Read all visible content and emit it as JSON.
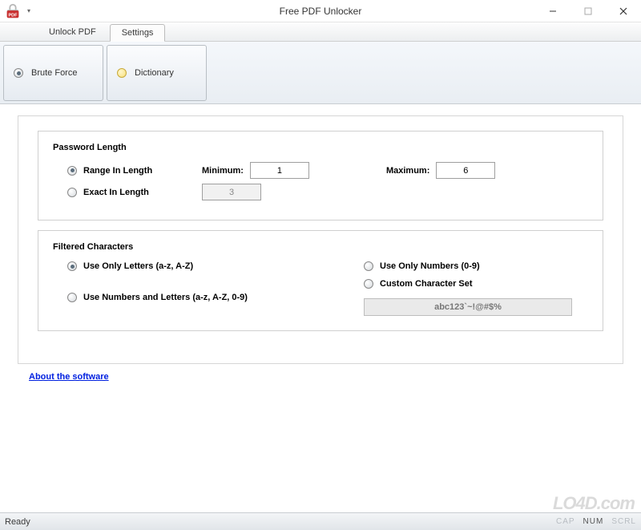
{
  "window": {
    "title": "Free PDF Unlocker"
  },
  "tabs": {
    "unlock": "Unlock PDF",
    "settings": "Settings"
  },
  "ribbon": {
    "brute_force": "Brute Force",
    "dictionary": "Dictionary"
  },
  "password_length": {
    "title": "Password Length",
    "range_label": "Range In Length",
    "exact_label": "Exact In Length",
    "min_label": "Minimum:",
    "max_label": "Maximum:",
    "min_value": "1",
    "max_value": "6",
    "exact_value": "3"
  },
  "filtered": {
    "title": "Filtered Characters",
    "letters": "Use Only Letters (a-z, A-Z)",
    "numbers": "Use Only Numbers (0-9)",
    "numletters": "Use Numbers and Letters (a-z, A-Z, 0-9)",
    "custom": "Custom Character Set",
    "custom_value": "abc123`~!@#$%"
  },
  "link": {
    "about": "About the software"
  },
  "status": {
    "ready": "Ready",
    "cap": "CAP",
    "num": "NUM",
    "scrl": "SCRL"
  },
  "watermark": "LO4D.com"
}
